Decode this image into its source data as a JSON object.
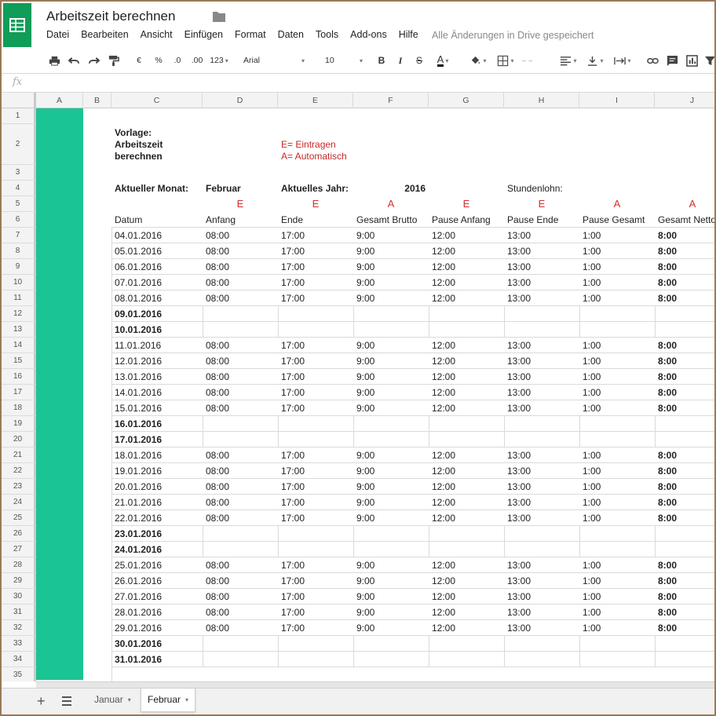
{
  "app": {
    "title": "Arbeitszeit berechnen",
    "save_status": "Alle Änderungen in Drive gespeichert",
    "brand_color": "#0f9d58"
  },
  "menu": [
    "Datei",
    "Bearbeiten",
    "Ansicht",
    "Einfügen",
    "Format",
    "Daten",
    "Tools",
    "Add-ons",
    "Hilfe"
  ],
  "toolbar": {
    "currency": "€",
    "percent": "%",
    "decrease_decimals": ".0",
    "increase_decimals": ".00",
    "more_formats": "123",
    "font": "Arial",
    "font_size": "10",
    "bold": "B",
    "italic": "I",
    "strike": "S",
    "text_color": "A"
  },
  "formula_bar": {
    "icon": "fx"
  },
  "columns": [
    "A",
    "B",
    "C",
    "D",
    "E",
    "F",
    "G",
    "H",
    "I",
    "J"
  ],
  "rows": [
    "1",
    "2",
    "3",
    "4",
    "5",
    "6",
    "7",
    "8",
    "9",
    "10",
    "11",
    "12",
    "13",
    "14",
    "15",
    "16",
    "17",
    "18",
    "19",
    "20",
    "21",
    "22",
    "23",
    "24",
    "25",
    "26",
    "27",
    "28",
    "29",
    "30",
    "31",
    "32",
    "33",
    "34",
    "35"
  ],
  "sheet": {
    "vorlage_label": "Vorlage:",
    "vorlage_line2": "Arbeitszeit",
    "vorlage_line3": "berechnen",
    "legend_e": "E= Eintragen",
    "legend_a": "A= Automatisch",
    "month_label": "Aktueller Monat:",
    "month_value": "Februar",
    "year_label": "Aktuelles Jahr:",
    "year_value": "2016",
    "wage_label": "Stundenlohn:",
    "markers": [
      "E",
      "E",
      "A",
      "E",
      "E",
      "A",
      "A"
    ],
    "headers": [
      "Datum",
      "Anfang",
      "Ende",
      "Gesamt Brutto",
      "Pause Anfang",
      "Pause Ende",
      "Pause Gesamt",
      "Gesamt Netto"
    ],
    "work_row": {
      "anfang": "08:00",
      "ende": "17:00",
      "brutto": "9:00",
      "pause_anfang": "12:00",
      "pause_ende": "13:00",
      "pause_gesamt": "1:00",
      "netto": "8:00"
    },
    "days": [
      {
        "date": "04.01.2016",
        "weekend": false
      },
      {
        "date": "05.01.2016",
        "weekend": false
      },
      {
        "date": "06.01.2016",
        "weekend": false
      },
      {
        "date": "07.01.2016",
        "weekend": false
      },
      {
        "date": "08.01.2016",
        "weekend": false
      },
      {
        "date": "09.01.2016",
        "weekend": true
      },
      {
        "date": "10.01.2016",
        "weekend": true
      },
      {
        "date": "11.01.2016",
        "weekend": false
      },
      {
        "date": "12.01.2016",
        "weekend": false
      },
      {
        "date": "13.01.2016",
        "weekend": false
      },
      {
        "date": "14.01.2016",
        "weekend": false
      },
      {
        "date": "15.01.2016",
        "weekend": false
      },
      {
        "date": "16.01.2016",
        "weekend": true
      },
      {
        "date": "17.01.2016",
        "weekend": true
      },
      {
        "date": "18.01.2016",
        "weekend": false
      },
      {
        "date": "19.01.2016",
        "weekend": false
      },
      {
        "date": "20.01.2016",
        "weekend": false
      },
      {
        "date": "21.01.2016",
        "weekend": false
      },
      {
        "date": "22.01.2016",
        "weekend": false
      },
      {
        "date": "23.01.2016",
        "weekend": true
      },
      {
        "date": "24.01.2016",
        "weekend": true
      },
      {
        "date": "25.01.2016",
        "weekend": false
      },
      {
        "date": "26.01.2016",
        "weekend": false
      },
      {
        "date": "27.01.2016",
        "weekend": false
      },
      {
        "date": "28.01.2016",
        "weekend": false
      },
      {
        "date": "29.01.2016",
        "weekend": false
      },
      {
        "date": "30.01.2016",
        "weekend": true
      },
      {
        "date": "31.01.2016",
        "weekend": true
      }
    ],
    "highlight_color": "#1bc493",
    "marker_color": "#d32f2f"
  },
  "tabs": [
    {
      "label": "Januar",
      "active": false
    },
    {
      "label": "Februar",
      "active": true
    }
  ]
}
